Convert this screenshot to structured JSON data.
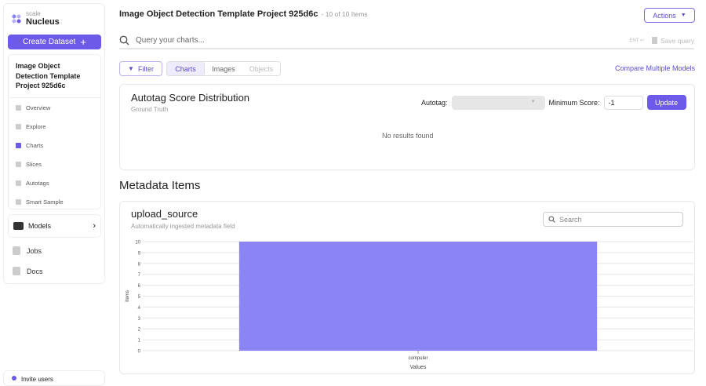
{
  "brand": {
    "small": "scale",
    "name": "Nucleus"
  },
  "sidebar": {
    "create_dataset": "Create Dataset",
    "project_title": "Image Object Detection Template Project 925d6c",
    "nav": [
      {
        "label": "Overview",
        "icon": "grid-icon"
      },
      {
        "label": "Explore",
        "icon": "table-icon"
      },
      {
        "label": "Charts",
        "icon": "chart-icon",
        "active": true
      },
      {
        "label": "Slices",
        "icon": "slices-icon"
      },
      {
        "label": "Autotags",
        "icon": "tag-icon"
      },
      {
        "label": "Smart Sample",
        "icon": "stack-icon"
      }
    ],
    "models": "Models",
    "jobs": "Jobs",
    "docs": "Docs",
    "invite": "Invite users"
  },
  "header": {
    "title": "Image Object Detection Template Project 925d6c",
    "count": "- 10 of 10 Items",
    "actions": "Actions"
  },
  "search": {
    "placeholder": "Query your charts...",
    "hint": "ENT ↩",
    "save": "Save query"
  },
  "toolbar": {
    "filter": "Filter",
    "tabs": [
      "Charts",
      "Images",
      "Objects"
    ],
    "compare": "Compare Multiple Models"
  },
  "autotag_card": {
    "title": "Autotag Score Distribution",
    "subtitle": "Ground Truth",
    "autotag_label": "Autotag:",
    "min_score_label": "Minimum Score:",
    "min_score_value": "-1",
    "update": "Update",
    "empty": "No results found"
  },
  "metadata": {
    "heading": "Metadata Items",
    "field": "upload_source",
    "description": "Automatically ingested metadata field",
    "search_placeholder": "Search"
  },
  "colors": {
    "accent": "#6b5be8",
    "bar": "#8b84f7"
  },
  "chart_data": {
    "type": "bar",
    "categories": [
      "computer"
    ],
    "values": [
      10
    ],
    "xlabel": "Values",
    "ylabel": "Items",
    "ylim": [
      0,
      10
    ],
    "yticks": [
      0,
      1,
      2,
      3,
      4,
      5,
      6,
      7,
      8,
      9,
      10
    ],
    "grid": true
  }
}
